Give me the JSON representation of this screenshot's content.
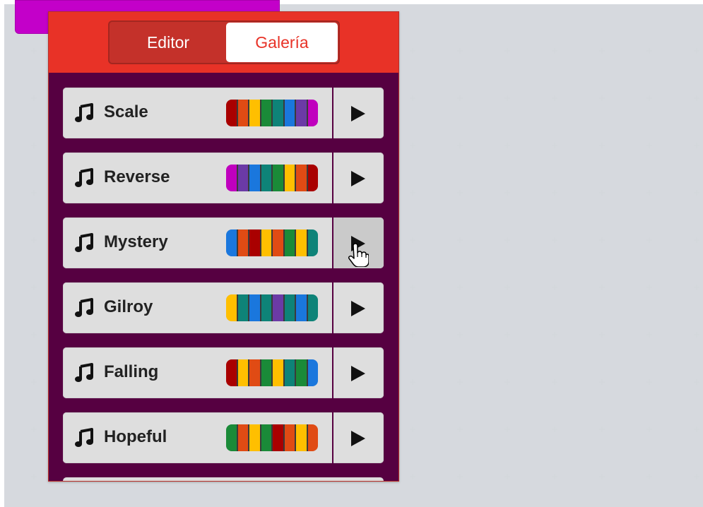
{
  "tabs": {
    "editor": "Editor",
    "gallery": "Galería",
    "active": "gallery"
  },
  "songs": [
    {
      "name": "Scale",
      "colors": [
        "#a90000",
        "#e04b14",
        "#ffbf00",
        "#1a8a38",
        "#0e8378",
        "#1a77dd",
        "#6b3aa6",
        "#c000be"
      ]
    },
    {
      "name": "Reverse",
      "colors": [
        "#c000be",
        "#6b3aa6",
        "#1a77dd",
        "#0e8378",
        "#1a8a38",
        "#ffbf00",
        "#e04b14",
        "#a90000"
      ]
    },
    {
      "name": "Mystery",
      "colors": [
        "#1a77dd",
        "#e04b14",
        "#a90000",
        "#ffbf00",
        "#e04b14",
        "#1a8a38",
        "#ffbf00",
        "#0e8378"
      ]
    },
    {
      "name": "Gilroy",
      "colors": [
        "#ffbf00",
        "#0e8378",
        "#1a77dd",
        "#0e8378",
        "#6b3aa6",
        "#0e8378",
        "#1a77dd",
        "#0e8378"
      ]
    },
    {
      "name": "Falling",
      "colors": [
        "#a90000",
        "#ffbf00",
        "#e04b14",
        "#1a8a38",
        "#ffbf00",
        "#0e8378",
        "#1a8a38",
        "#1a77dd"
      ]
    },
    {
      "name": "Hopeful",
      "colors": [
        "#1a8a38",
        "#e04b14",
        "#ffbf00",
        "#1a8a38",
        "#a90000",
        "#e04b14",
        "#ffbf00",
        "#e04b14"
      ]
    }
  ],
  "hovered_play_index": 2,
  "colors": {
    "header": "#e83227",
    "flyout_bg": "#560041",
    "block": "#c300c9"
  }
}
